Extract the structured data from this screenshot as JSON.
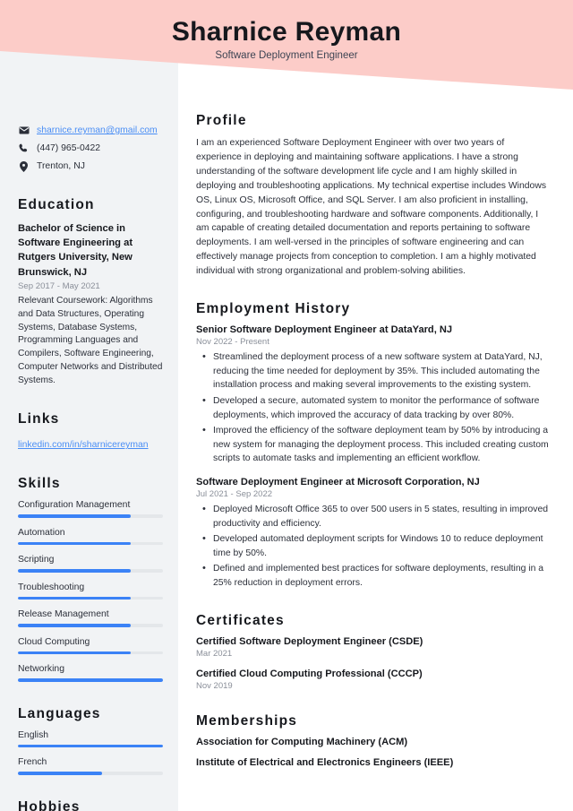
{
  "header": {
    "name": "Sharnice Reyman",
    "job_title": "Software Deployment Engineer",
    "banner_color": "#fcccc8"
  },
  "sidebar": {
    "background_color": "#f1f3f5",
    "contact": {
      "email": "sharnice.reyman@gmail.com",
      "phone": "(447) 965-0422",
      "location": "Trenton, NJ",
      "email_icon": "envelope-icon",
      "phone_icon": "phone-icon",
      "location_icon": "map-pin-icon"
    },
    "education": {
      "heading": "Education",
      "degree": "Bachelor of Science in Software Engineering at Rutgers University, New Brunswick, NJ",
      "date": "Sep 2017 - May 2021",
      "coursework": "Relevant Coursework: Algorithms and Data Structures, Operating Systems, Database Systems, Programming Languages and Compilers, Software Engineering, Computer Networks and Distributed Systems."
    },
    "links": {
      "heading": "Links",
      "items": [
        {
          "label": "linkedin.com/in/sharnicereyman"
        }
      ]
    },
    "skills": {
      "heading": "Skills",
      "accent_color": "#3b82f6",
      "track_color": "#e4e7ea",
      "items": [
        {
          "label": "Configuration Management",
          "level": 78
        },
        {
          "label": "Automation",
          "level": 78
        },
        {
          "label": "Scripting",
          "level": 78
        },
        {
          "label": "Troubleshooting",
          "level": 78
        },
        {
          "label": "Release Management",
          "level": 78
        },
        {
          "label": "Cloud Computing",
          "level": 78
        },
        {
          "label": "Networking",
          "level": 100
        }
      ]
    },
    "languages": {
      "heading": "Languages",
      "items": [
        {
          "label": "English",
          "level": 100
        },
        {
          "label": "French",
          "level": 58
        }
      ]
    },
    "hobbies": {
      "heading": "Hobbies"
    }
  },
  "main": {
    "profile": {
      "heading": "Profile",
      "text": "I am an experienced Software Deployment Engineer with over two years of experience in deploying and maintaining software applications. I have a strong understanding of the software development life cycle and I am highly skilled in deploying and troubleshooting applications. My technical expertise includes Windows OS, Linux OS, Microsoft Office, and SQL Server. I am also proficient in installing, configuring, and troubleshooting hardware and software components. Additionally, I am capable of creating detailed documentation and reports pertaining to software deployments. I am well-versed in the principles of software engineering and can effectively manage projects from conception to completion. I am a highly motivated individual with strong organizational and problem-solving abilities."
    },
    "employment": {
      "heading": "Employment History",
      "jobs": [
        {
          "title": "Senior Software Deployment Engineer at DataYard, NJ",
          "date": "Nov 2022 - Present",
          "bullets": [
            "Streamlined the deployment process of a new software system at DataYard, NJ, reducing the time needed for deployment by 35%. This included automating the installation process and making several improvements to the existing system.",
            "Developed a secure, automated system to monitor the performance of software deployments, which improved the accuracy of data tracking by over 80%.",
            "Improved the efficiency of the software deployment team by 50% by introducing a new system for managing the deployment process. This included creating custom scripts to automate tasks and implementing an efficient workflow."
          ]
        },
        {
          "title": "Software Deployment Engineer at Microsoft Corporation, NJ",
          "date": "Jul 2021 - Sep 2022",
          "bullets": [
            "Deployed Microsoft Office 365 to over 500 users in 5 states, resulting in improved productivity and efficiency.",
            "Developed automated deployment scripts for Windows 10 to reduce deployment time by 50%.",
            "Defined and implemented best practices for software deployments, resulting in a 25% reduction in deployment errors."
          ]
        }
      ]
    },
    "certificates": {
      "heading": "Certificates",
      "items": [
        {
          "name": "Certified Software Deployment Engineer (CSDE)",
          "date": "Mar 2021"
        },
        {
          "name": "Certified Cloud Computing Professional (CCCP)",
          "date": "Nov 2019"
        }
      ]
    },
    "memberships": {
      "heading": "Memberships",
      "items": [
        {
          "name": "Association for Computing Machinery (ACM)"
        },
        {
          "name": "Institute of Electrical and Electronics Engineers (IEEE)"
        }
      ]
    }
  }
}
